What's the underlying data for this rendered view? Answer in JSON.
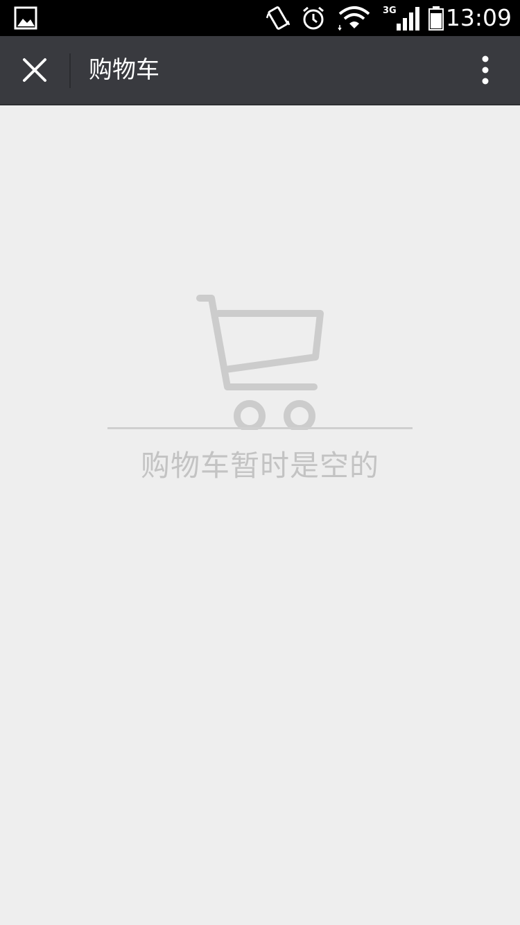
{
  "status_bar": {
    "time": "13:09",
    "network": "3G",
    "icons": [
      "image-notification-icon",
      "vibrate-icon",
      "alarm-icon",
      "wifi-icon",
      "signal-icon",
      "battery-icon"
    ]
  },
  "app_bar": {
    "title": "购物车",
    "close_icon": "close-icon",
    "more_icon": "more-vertical-icon"
  },
  "empty_state": {
    "message": "购物车暂时是空的",
    "icon": "shopping-cart-icon",
    "icon_color": "#cccccc"
  },
  "colors": {
    "status_bar_bg": "#000000",
    "app_bar_bg": "#393a3f",
    "page_bg": "#eeeeee",
    "empty_text": "#c3c3c3"
  }
}
